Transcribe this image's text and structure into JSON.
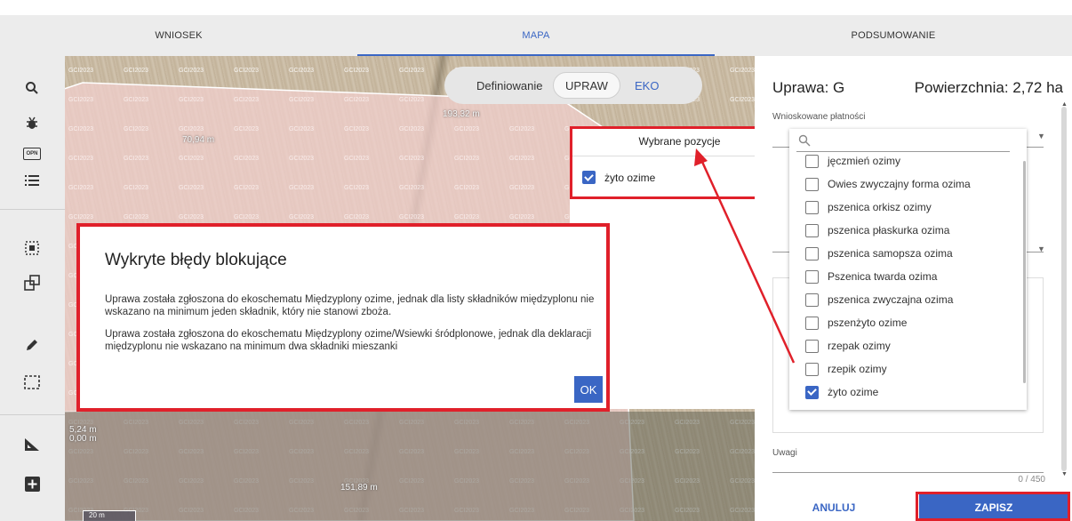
{
  "tabs": [
    {
      "label": "WNIOSEK"
    },
    {
      "label": "MAPA"
    },
    {
      "label": "PODSUMOWANIE"
    }
  ],
  "active_tab": "MAPA",
  "toolbar": {
    "icons": [
      "search-icon",
      "bug-icon",
      "orn-icon",
      "list-icon",
      "select-area-icon",
      "copy-icon",
      "edit-pencil-icon",
      "select-rectangle-icon",
      "measure-angle-icon",
      "add-icon"
    ],
    "orn_text": "OPN"
  },
  "map": {
    "labels": [
      "70,94 m",
      "193,32 m",
      "5,24 m",
      "0,00 m",
      "151,89 m",
      "20 m"
    ],
    "watermark": "GCI2023"
  },
  "define_toggle": {
    "label": "Definiowanie",
    "option_upraw": "UPRAW",
    "option_eko": "EKO"
  },
  "selected_positions": {
    "header": "Wybrane pozycje",
    "items": [
      {
        "label": "żyto ozime",
        "checked": true
      }
    ]
  },
  "side_panel": {
    "title": "Uprawa: G",
    "area": "Powierzchnia: 2,72 ha",
    "payments_label": "Wnioskowane płatności",
    "remarks_label": "Uwagi",
    "counter": "0 / 450",
    "cancel_label": "ANULUJ",
    "save_label": "ZAPISZ"
  },
  "crop_options": [
    {
      "label": "jęczmień ozimy",
      "checked": false
    },
    {
      "label": "Owies zwyczajny forma ozima",
      "checked": false
    },
    {
      "label": "pszenica orkisz ozimy",
      "checked": false
    },
    {
      "label": "pszenica płaskurka ozima",
      "checked": false
    },
    {
      "label": "pszenica samopsza ozima",
      "checked": false
    },
    {
      "label": "Pszenica twarda ozima",
      "checked": false
    },
    {
      "label": "pszenica zwyczajna ozima",
      "checked": false
    },
    {
      "label": "pszenżyto ozime",
      "checked": false
    },
    {
      "label": "rzepak ozimy",
      "checked": false
    },
    {
      "label": "rzepik ozimy",
      "checked": false
    },
    {
      "label": "żyto ozime",
      "checked": true
    }
  ],
  "error_dialog": {
    "title": "Wykryte błędy blokujące",
    "message_1": "Uprawa została zgłoszona do ekoschematu Międzyplony ozime, jednak dla listy składników międzyplonu nie wskazano na minimum jeden składnik, który nie stanowi zboża.",
    "message_2": "Uprawa została zgłoszona do ekoschematu Międzyplony ozime/Wsiewki śródplonowe, jednak dla deklaracji międzyplonu nie wskazano na minimum dwa składniki mieszanki",
    "ok_label": "OK"
  },
  "colors": {
    "accent": "#3a66c4",
    "highlight_red": "#e0202a",
    "parcel_fill": "#f2d0cf"
  }
}
